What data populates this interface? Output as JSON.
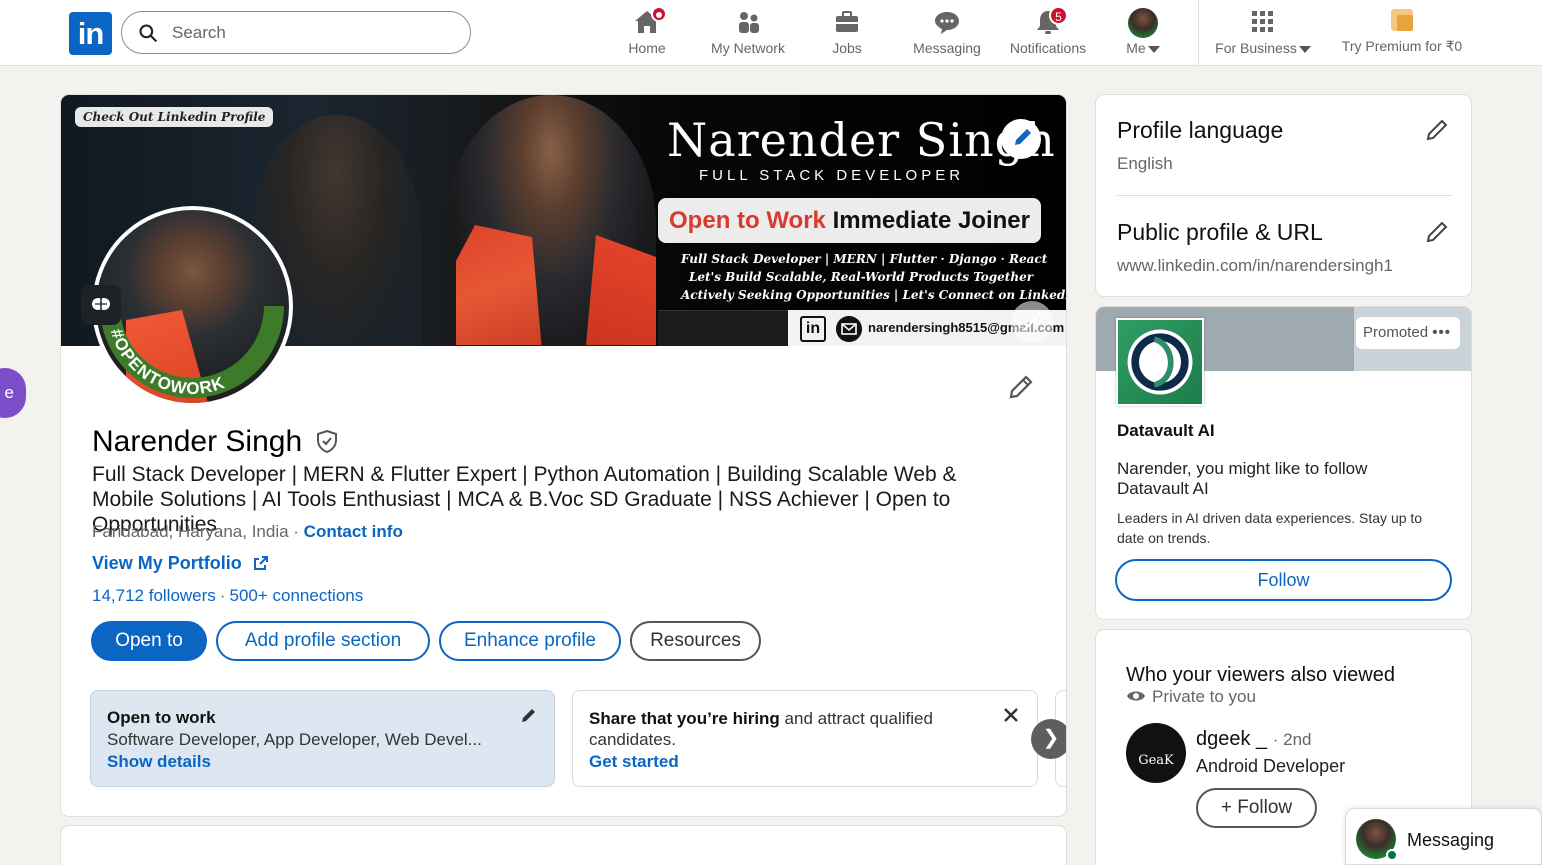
{
  "nav": {
    "logo": "in",
    "search_placeholder": "Search",
    "items": [
      {
        "label": "Home",
        "icon": "home-icon"
      },
      {
        "label": "My Network",
        "icon": "network-icon"
      },
      {
        "label": "Jobs",
        "icon": "briefcase-icon"
      },
      {
        "label": "Messaging",
        "icon": "chat-icon"
      },
      {
        "label": "Notifications",
        "icon": "bell-icon",
        "badge": "5"
      },
      {
        "label": "Me",
        "icon": "avatar"
      },
      {
        "label": "For Business",
        "icon": "grid-icon"
      },
      {
        "label": "Try Premium for ₹0",
        "icon": "premium-icon"
      }
    ]
  },
  "banner": {
    "tag": "Check Out Linkedin Profile",
    "name": "Narender Singh",
    "role": "FULL STACK DEVELOPER",
    "pill_red": "Open to Work",
    "pill_dark": "Immediate Joiner",
    "lines": [
      "Full Stack Developer | MERN | Flutter · Django · React",
      "Let's Build Scalable, Real-World Products Together",
      "Actively Seeking Opportunities | Let's Connect on LinkedIn"
    ],
    "email": "narendersingh8515@gmail.com",
    "avatar_frame": "#OPENTOWORK"
  },
  "profile": {
    "name": "Narender Singh",
    "headline": "Full Stack Developer | MERN & Flutter Expert | Python Automation | Building Scalable Web & Mobile Solutions | AI Tools Enthusiast | MCA & B.Voc SD Graduate | NSS Achiever | Open to Opportunities",
    "location": "Faridabad, Haryana, India",
    "contact_info": "Contact info",
    "portfolio": "View My Portfolio",
    "followers": "14,712 followers",
    "connections": "500+ connections",
    "buttons": {
      "open_to": "Open to",
      "add_section": "Add profile section",
      "enhance": "Enhance profile",
      "resources": "Resources"
    },
    "open_to_work": {
      "title": "Open to work",
      "roles": "Software Developer, App Developer, Web Devel...",
      "link": "Show details"
    },
    "hiring": {
      "bold": "Share that you’re hiring",
      "rest": " and attract qualified candidates.",
      "link": "Get started"
    },
    "side_tab": "e"
  },
  "sidebar": {
    "language": {
      "title": "Profile language",
      "value": "English"
    },
    "public_url": {
      "title": "Public profile & URL",
      "value": "www.linkedin.com/in/narendersingh1"
    },
    "ad": {
      "promoted": "Promoted",
      "company": "Datavault AI",
      "copy": "Narender, you might like to follow Datavault AI",
      "desc": "Leaders in AI driven data experiences. Stay up to date on trends.",
      "follow": "Follow"
    },
    "viewers": {
      "title": "Who your viewers also viewed",
      "privacy": "Private to you",
      "person": {
        "name": "dgeek _",
        "degree": "· 2nd",
        "title": "Android Developer",
        "avatar_text": "GeaK",
        "follow": "+ Follow"
      }
    }
  },
  "messaging": {
    "label": "Messaging"
  },
  "colors": {
    "brand": "#0a66c2",
    "badge": "#cb112d",
    "open_to_work_green": "#1e7c34"
  }
}
